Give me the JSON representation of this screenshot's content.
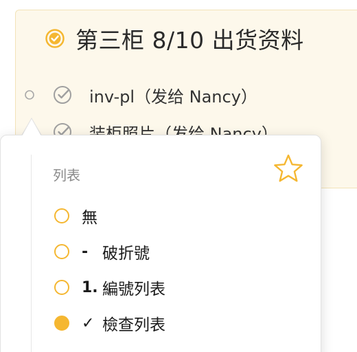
{
  "note": {
    "title": "第三柜 8/10 出货资料",
    "tasks": [
      {
        "label": "inv-pl（发给 Nancy）"
      },
      {
        "label": "装柜照片（发给 Nancy）"
      }
    ]
  },
  "popover": {
    "section_label": "列表",
    "options": [
      {
        "prefix": "",
        "label": "無",
        "selected": false
      },
      {
        "prefix": "-",
        "label": "破折號",
        "selected": false
      },
      {
        "prefix": "1.",
        "label": "編號列表",
        "selected": false
      },
      {
        "prefix": "✓",
        "label": "檢查列表",
        "selected": true
      }
    ]
  },
  "colors": {
    "accent": "#f5b731",
    "check_gray": "#9a9a9a",
    "card_bg": "#fdf8eb"
  }
}
